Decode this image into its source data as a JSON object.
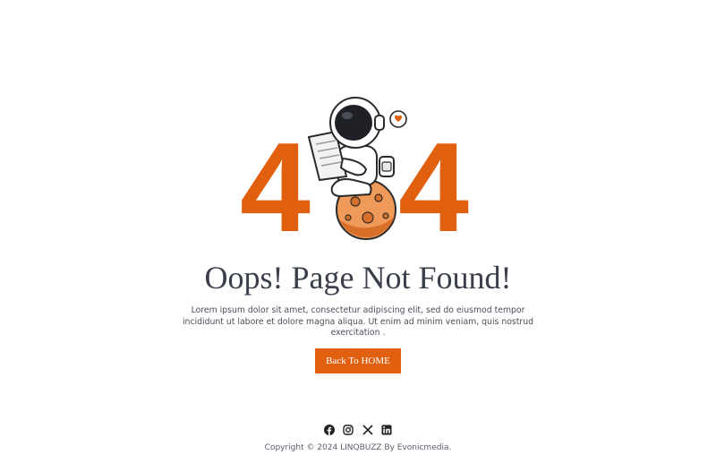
{
  "error": {
    "digit_left": "4",
    "digit_right": "4",
    "title": "Oops! Page Not Found!",
    "description": "Lorem ipsum dolor sit amet, consectetur adipiscing elit, sed do eiusmod tempor incididunt ut labore et dolore magna aliqua. Ut enim ad minim veniam, quis nostrud exercitation .",
    "button_label": "Back To HOME"
  },
  "social": {
    "icons": [
      "facebook-icon",
      "instagram-icon",
      "x-icon",
      "linkedin-icon"
    ]
  },
  "footer": {
    "copyright": "Copyright © 2024 LINQBUZZ By Evonicmedia."
  },
  "colors": {
    "accent": "#e0600f",
    "title": "#3a3f4b",
    "body_text": "#4a4f5a"
  }
}
